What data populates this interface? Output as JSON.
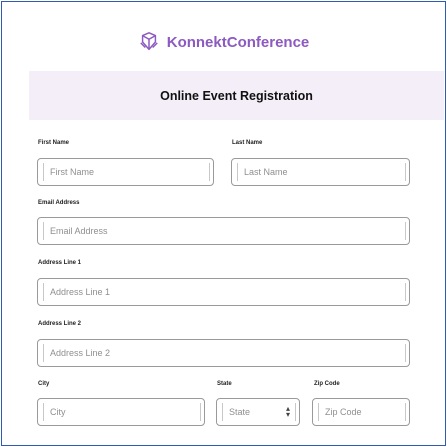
{
  "brand": {
    "name": "KonnektConference",
    "icon": "brand-logo-icon",
    "color": "#8c5ac0"
  },
  "form": {
    "title": "Online Event Registration",
    "first_name": {
      "label": "First Name",
      "placeholder": "First Name",
      "value": ""
    },
    "last_name": {
      "label": "Last Name",
      "placeholder": "Last Name",
      "value": ""
    },
    "email": {
      "label": "Email Address",
      "placeholder": "Email Address",
      "value": ""
    },
    "address1": {
      "label": "Address Line 1",
      "placeholder": "Address Line 1",
      "value": ""
    },
    "address2": {
      "label": "Address Line 2",
      "placeholder": "Address Line 2",
      "value": ""
    },
    "city": {
      "label": "City",
      "placeholder": "City",
      "value": ""
    },
    "state": {
      "label": "State",
      "selected": "State"
    },
    "zip": {
      "label": "Zip Code",
      "placeholder": "Zip Code",
      "value": ""
    }
  },
  "colors": {
    "frame_border": "#2f5bb4",
    "banner_bg": "#f3eef7",
    "accent": "#8c5ac0"
  }
}
